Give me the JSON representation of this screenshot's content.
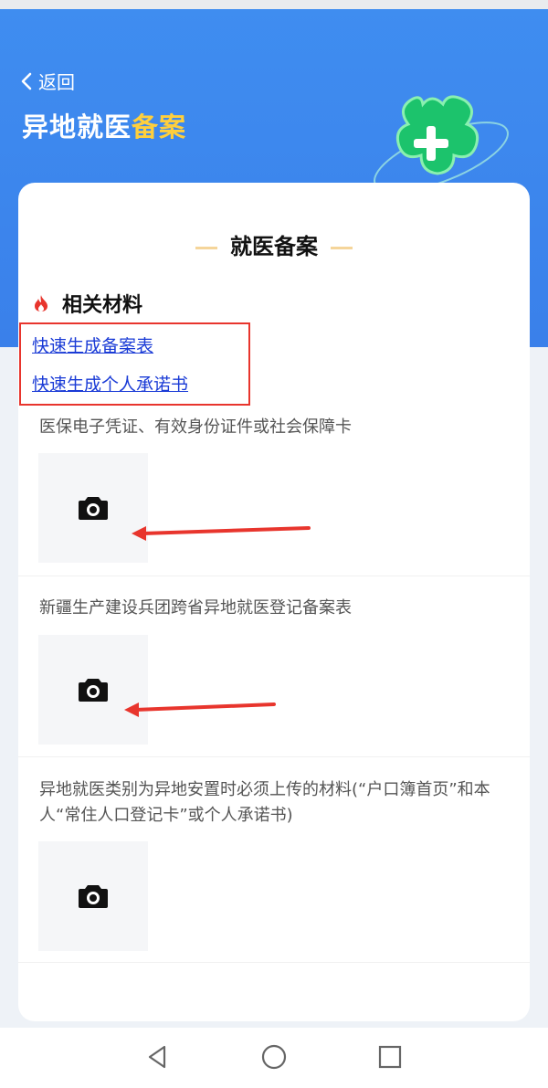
{
  "header": {
    "back_label": "返回",
    "title_main": "异地就医",
    "title_highlight": "备案"
  },
  "card": {
    "section_title": "就医备案",
    "related_title": "相关材料",
    "links": [
      {
        "label": "快速生成备案表"
      },
      {
        "label": "快速生成个人承诺书"
      }
    ],
    "upload_items": [
      {
        "label": "医保电子凭证、有效身份证件或社会保障卡"
      },
      {
        "label": "新疆生产建设兵团跨省异地就医登记备案表"
      },
      {
        "label": "异地就医类别为异地安置时必须上传的材料(“户口簿首页”和本人“常住人口登记卡”或个人承诺书)"
      }
    ]
  },
  "icons": {
    "back": "chevron-left-icon",
    "fire": "fire-icon",
    "camera": "camera-icon",
    "nav": [
      "back-triangle-icon",
      "home-circle-icon",
      "recents-square-icon"
    ]
  },
  "colors": {
    "header_bg": "#3f8df0",
    "title_highlight": "#ffcf3c",
    "link": "#1a3bd6",
    "annotation_red": "#e8352d"
  }
}
